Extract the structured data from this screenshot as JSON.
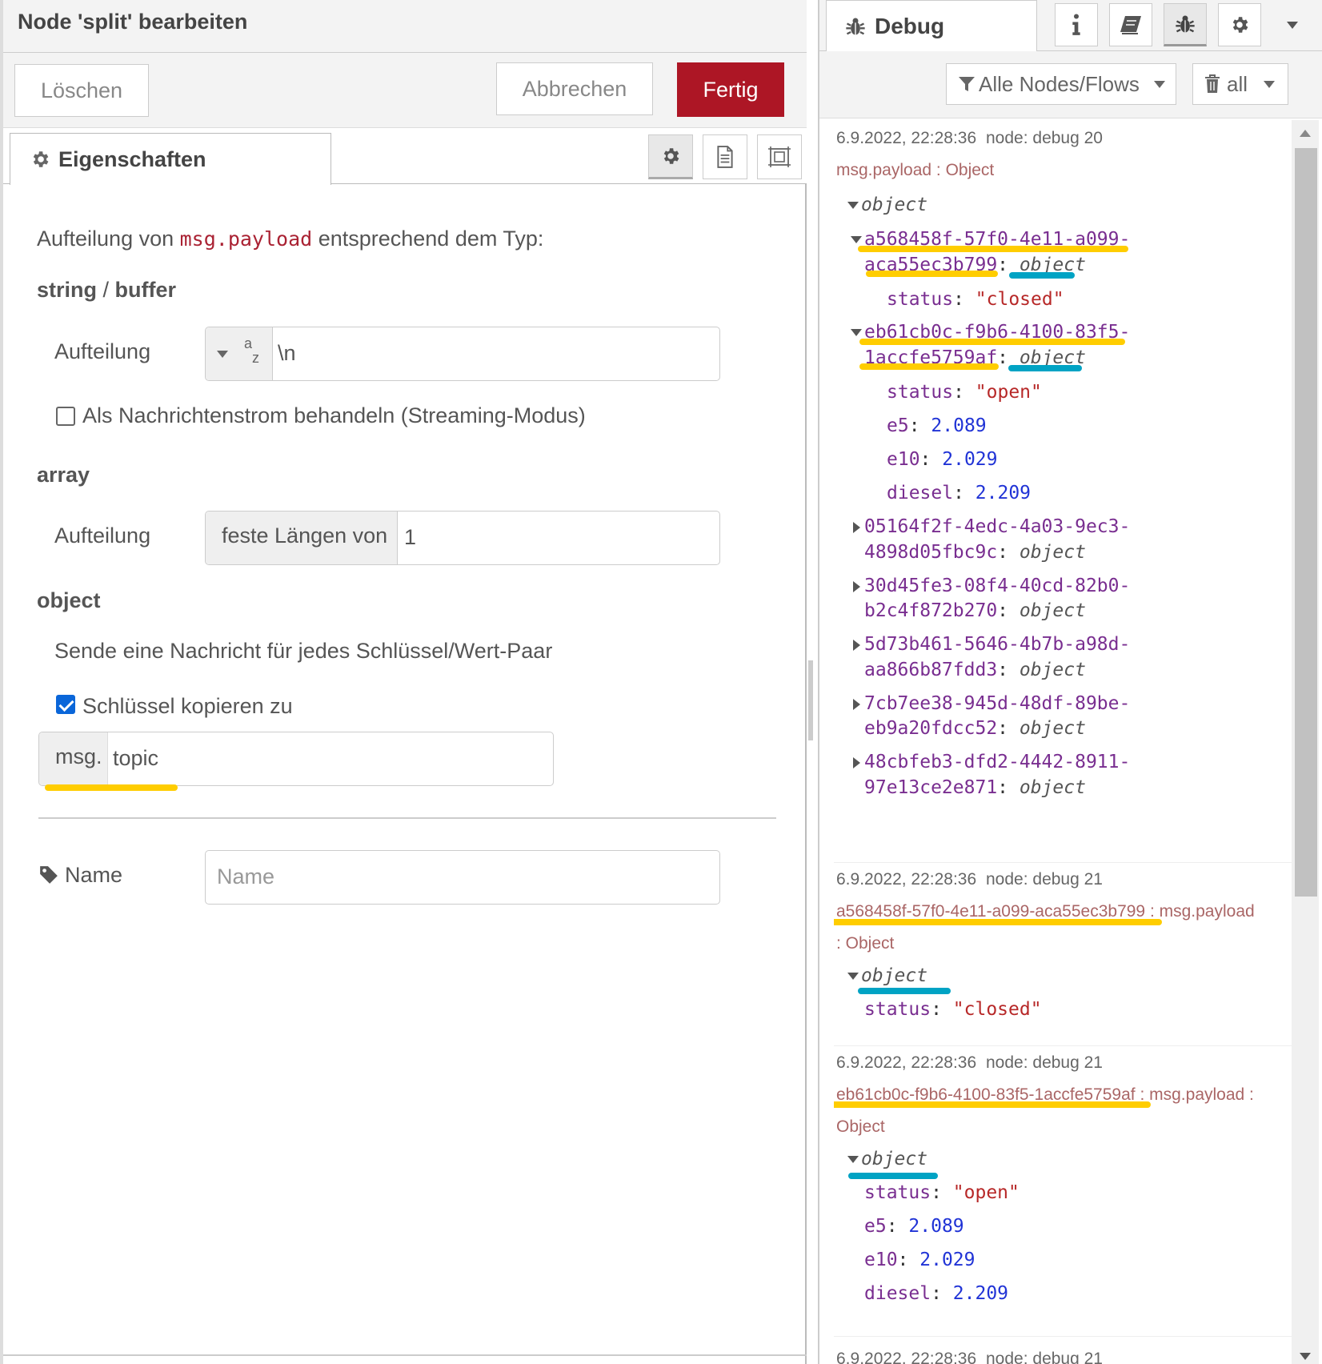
{
  "editor": {
    "title": "Node 'split' bearbeiten",
    "delete_label": "Löschen",
    "cancel_label": "Abbrechen",
    "done_label": "Fertig",
    "tab_properties": "Eigenschaften",
    "intro_prefix": "Aufteilung von ",
    "intro_code": "msg.payload",
    "intro_suffix": " entsprechend dem Typ:",
    "section_string_a": "string",
    "section_string_sep": " / ",
    "section_string_b": "buffer",
    "split_label": "Aufteilung",
    "string_type_glyph_top": "a",
    "string_type_glyph_bottom": "z",
    "string_split_value": "\\n",
    "streaming_label": "Als Nachrichtenstrom behandeln (Streaming-Modus)",
    "streaming_checked": false,
    "section_array": "array",
    "array_split_label": "Aufteilung",
    "array_mode": "feste Längen von",
    "array_value": "1",
    "section_object": "object",
    "object_desc": "Sende eine Nachricht für jedes Schlüssel/Wert-Paar",
    "copy_key_label": "Schlüssel kopieren zu",
    "copy_key_checked": true,
    "msg_prefix": "msg.",
    "msg_property": "topic",
    "name_label": "Name",
    "name_placeholder": "Name"
  },
  "debug": {
    "tab_label": "Debug",
    "filter_label": "Alle Nodes/Flows",
    "clear_label": "all",
    "messages": [
      {
        "timestamp": "6.9.2022, 22:28:36",
        "node": "node: debug 20",
        "topic": "msg.payload : Object",
        "root": "object",
        "items": [
          {
            "key_line1": "a568458f-57f0-4e11-a099-",
            "key_line2": "aca55ec3b799",
            "type": "object",
            "expanded": true,
            "children": [
              {
                "k": "status",
                "v": "\"closed\"",
                "t": "str"
              }
            ]
          },
          {
            "key_line1": "eb61cb0c-f9b6-4100-83f5-",
            "key_line2": "1accfe5759af",
            "type": "object",
            "expanded": true,
            "children": [
              {
                "k": "status",
                "v": "\"open\"",
                "t": "str"
              },
              {
                "k": "e5",
                "v": "2.089",
                "t": "num"
              },
              {
                "k": "e10",
                "v": "2.029",
                "t": "num"
              },
              {
                "k": "diesel",
                "v": "2.209",
                "t": "num"
              }
            ]
          },
          {
            "key_line1": "05164f2f-4edc-4a03-9ec3-",
            "key_line2": "4898d05fbc9c",
            "type": "object",
            "expanded": false
          },
          {
            "key_line1": "30d45fe3-08f4-40cd-82b0-",
            "key_line2": "b2c4f872b270",
            "type": "object",
            "expanded": false
          },
          {
            "key_line1": "5d73b461-5646-4b7b-a98d-",
            "key_line2": "aa866b87fdd3",
            "type": "object",
            "expanded": false
          },
          {
            "key_line1": "7cb7ee38-945d-48df-89be-",
            "key_line2": "eb9a20fdcc52",
            "type": "object",
            "expanded": false
          },
          {
            "key_line1": "48cbfeb3-dfd2-4442-8911-",
            "key_line2": "97e13ce2e871",
            "type": "object",
            "expanded": false
          }
        ]
      },
      {
        "timestamp": "6.9.2022, 22:28:36",
        "node": "node: debug 21",
        "topic_key": "a568458f-57f0-4e11-a099-aca55ec3b799",
        "topic_rest_1": " : msg.payload",
        "topic_rest_2": ": Object",
        "root": "object",
        "children": [
          {
            "k": "status",
            "v": "\"closed\"",
            "t": "str"
          }
        ]
      },
      {
        "timestamp": "6.9.2022, 22:28:36",
        "node": "node: debug 21",
        "topic_key": "eb61cb0c-f9b6-4100-83f5-1accfe5759af",
        "topic_rest_1": " : msg.payload :",
        "topic_rest_2": "Object",
        "root": "object",
        "children": [
          {
            "k": "status",
            "v": "\"open\"",
            "t": "str"
          },
          {
            "k": "e5",
            "v": "2.089",
            "t": "num"
          },
          {
            "k": "e10",
            "v": "2.029",
            "t": "num"
          },
          {
            "k": "diesel",
            "v": "2.209",
            "t": "num"
          }
        ]
      },
      {
        "timestamp": "6.9.2022, 22:28:36",
        "node": "node: debug 21"
      }
    ]
  },
  "colors": {
    "primary_button": "#ad1625",
    "highlight_yellow": "#ffcd00",
    "highlight_blue": "#00a3c4",
    "key_purple": "#792e90",
    "string_red": "#b72828",
    "number_blue": "#2033d6",
    "code_red": "#aa2233"
  },
  "icons": [
    "cog-icon",
    "file-text-icon",
    "frame-icon",
    "tag-icon",
    "bug-icon",
    "info-icon",
    "book-icon",
    "filter-icon",
    "trash-icon",
    "caret-down-icon"
  ]
}
